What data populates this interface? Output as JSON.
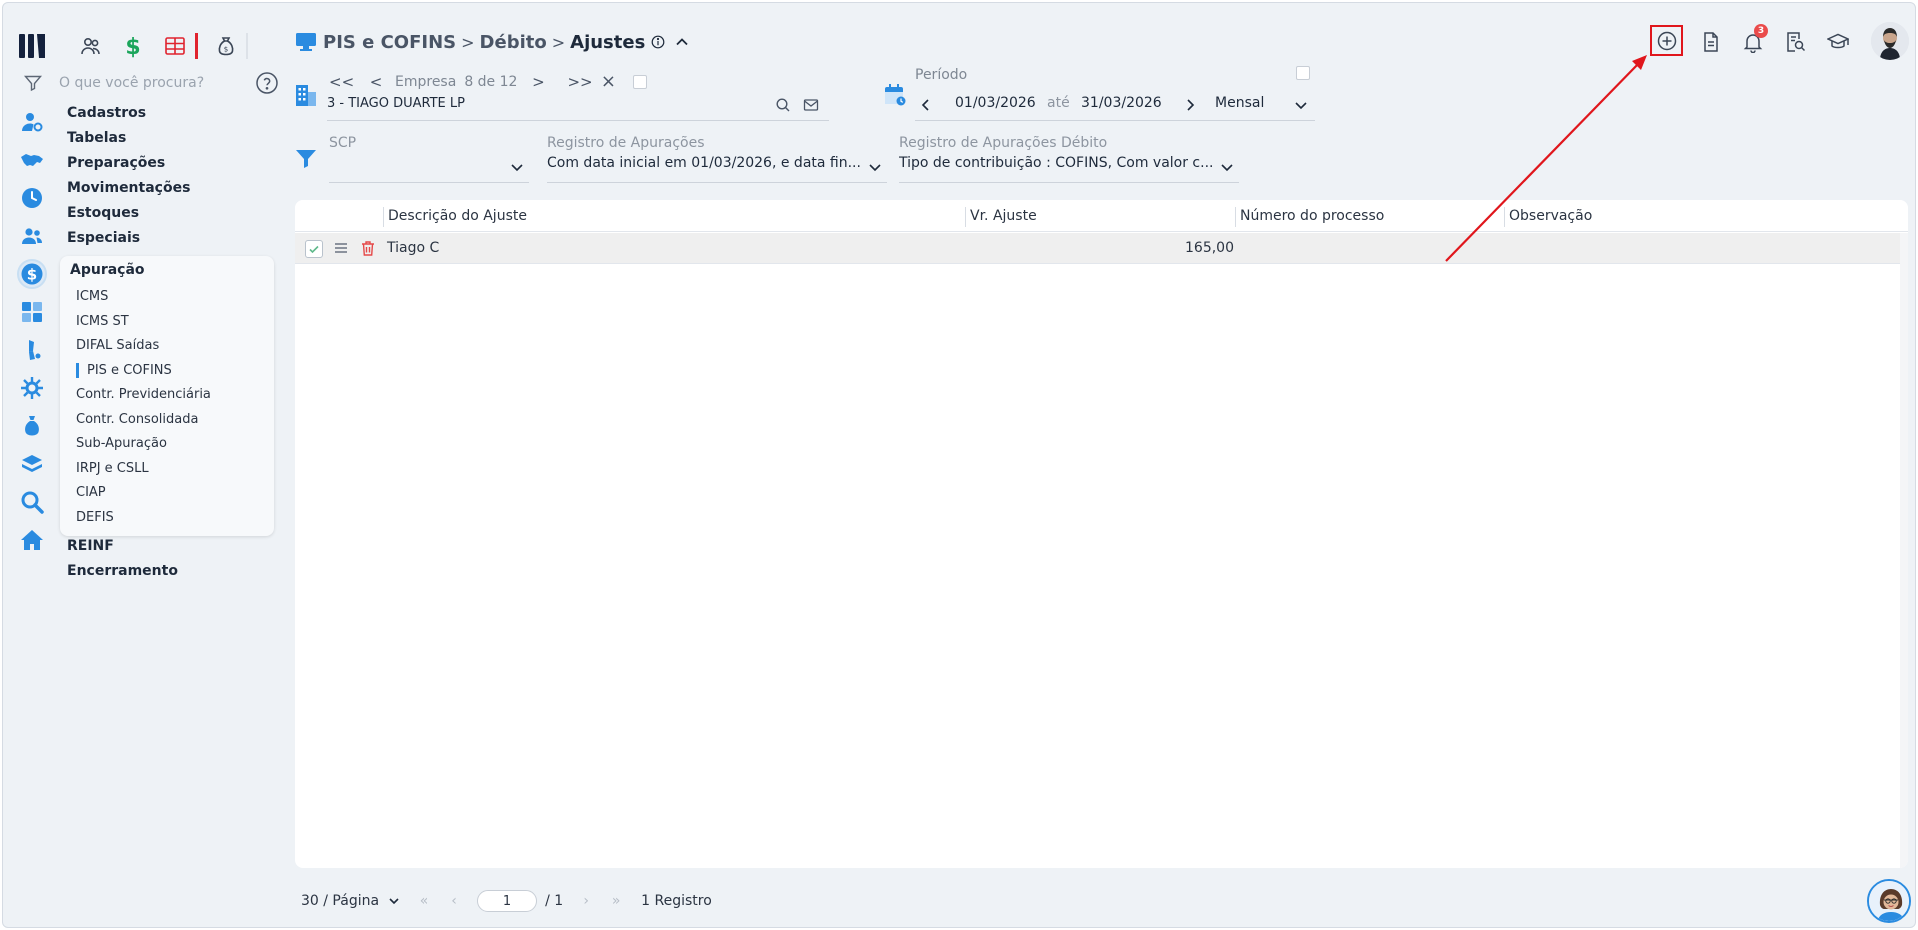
{
  "search": {
    "placeholder": "O que você procura?"
  },
  "sidebar": {
    "items": [
      {
        "label": "Cadastros",
        "icon": "user-gear-icon"
      },
      {
        "label": "Tabelas",
        "icon": "handshake-icon"
      },
      {
        "label": "Preparações",
        "icon": "clock-icon"
      },
      {
        "label": "Movimentações",
        "icon": "users-icon"
      },
      {
        "label": "Estoques",
        "icon": "dollar-circle-icon"
      },
      {
        "label": "Especiais",
        "icon": "calculator-icon"
      }
    ],
    "submenu": {
      "title": "Apuração",
      "items": [
        "ICMS",
        "ICMS ST",
        "DIFAL Saídas",
        "PIS e COFINS",
        "Contr. Previdenciária",
        "Contr. Consolidada",
        "Sub-Apuração",
        "IRPJ e CSLL",
        "CIAP",
        "DEFIS"
      ],
      "current": "PIS e COFINS"
    },
    "after": [
      "REINF",
      "Encerramento"
    ]
  },
  "header": {
    "crumb1": "PIS e COFINS",
    "crumb2": "Débito",
    "crumb3": "Ajustes",
    "sep": ">"
  },
  "notifications": {
    "count": "3"
  },
  "empresa": {
    "label": "Empresa",
    "position": "8 de 12",
    "first": "<<",
    "prev": "<",
    "next": ">",
    "last": ">>",
    "clear": "×",
    "value": "3 - TIAGO DUARTE LP"
  },
  "periodo": {
    "label": "Período",
    "start": "01/03/2026",
    "ate": "até",
    "end": "31/03/2026",
    "frequency": "Mensal"
  },
  "filters": {
    "scp": {
      "label": "SCP",
      "value": ""
    },
    "registro": {
      "label": "Registro de Apurações",
      "value": "Com data inicial em 01/03/2026, e data fin..."
    },
    "registro_debito": {
      "label": "Registro de Apurações Débito",
      "value": "Tipo de contribuição : COFINS, Com valor c..."
    }
  },
  "table": {
    "columns": [
      "Descrição do Ajuste",
      "Vr. Ajuste",
      "Número do processo",
      "Observação"
    ],
    "rows": [
      {
        "descricao": "Tiago C",
        "valor": "165,00",
        "processo": "",
        "observacao": ""
      }
    ]
  },
  "pager": {
    "per_page": "30 / Página",
    "current_page": "1",
    "total_pages": "/ 1",
    "records": "1 Registro"
  },
  "colors": {
    "accent": "#2a8be0",
    "highlight": "#e0161c",
    "badge": "#ea4b4b",
    "green": "#1aa55b"
  }
}
